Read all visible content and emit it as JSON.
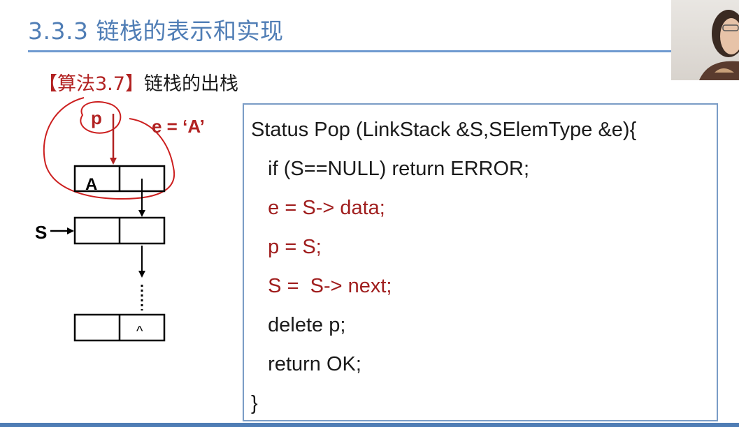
{
  "slide": {
    "title": "3.3.3 链栈的表示和实现",
    "algo_bracket_label": "【算法3.7】",
    "algo_name": "链栈的出栈"
  },
  "diagram": {
    "pointer_p": "p",
    "assign_e": "e = ‘A’",
    "node_top_data": "A",
    "pointer_s": "S",
    "null_mark": "^"
  },
  "code": {
    "lines": [
      "Status Pop (LinkStack &S,SElemType &e){",
      "   if (S==NULL) return ERROR;",
      "   e = S-> data;",
      "   p = S;",
      "   S =  S-> next;",
      "   delete p;",
      "   return OK;",
      "}"
    ]
  },
  "colors": {
    "title_blue": "#4f7db5",
    "accent_red": "#b22222",
    "box_border": "#7a9cc6"
  }
}
